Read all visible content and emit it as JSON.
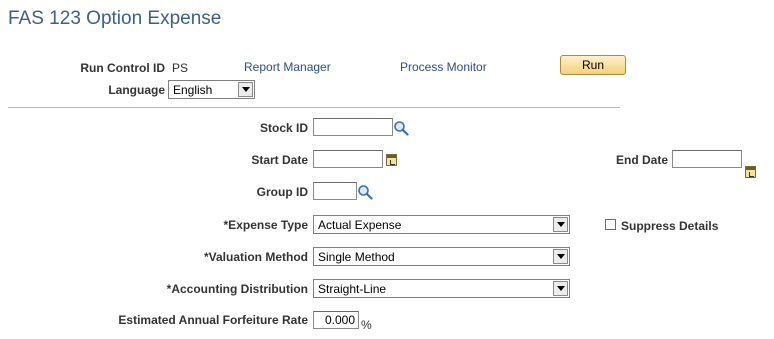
{
  "page": {
    "title": "FAS 123 Option Expense"
  },
  "run_control": {
    "label": "Run Control ID",
    "value": "PS",
    "report_manager": "Report Manager",
    "process_monitor": "Process Monitor",
    "run_button": "Run",
    "language_label": "Language",
    "language_value": "English"
  },
  "form": {
    "stock_id": {
      "label": "Stock ID",
      "value": "",
      "icon": "lookup-icon"
    },
    "start_date": {
      "label": "Start Date",
      "value": "",
      "icon": "calendar-icon"
    },
    "end_date": {
      "label": "End Date",
      "value": "",
      "icon": "calendar-icon"
    },
    "group_id": {
      "label": "Group ID",
      "value": "",
      "icon": "lookup-icon"
    },
    "expense_type": {
      "label": "*Expense Type",
      "value": "Actual Expense"
    },
    "suppress_details": {
      "label": "Suppress Details",
      "checked": false
    },
    "valuation_method": {
      "label": "*Valuation Method",
      "value": "Single Method"
    },
    "accounting_distribution": {
      "label": "*Accounting Distribution",
      "value": "Straight-Line"
    },
    "forfeiture_rate": {
      "label": "Estimated Annual Forfeiture Rate",
      "value": "0.000",
      "unit": "%"
    }
  }
}
